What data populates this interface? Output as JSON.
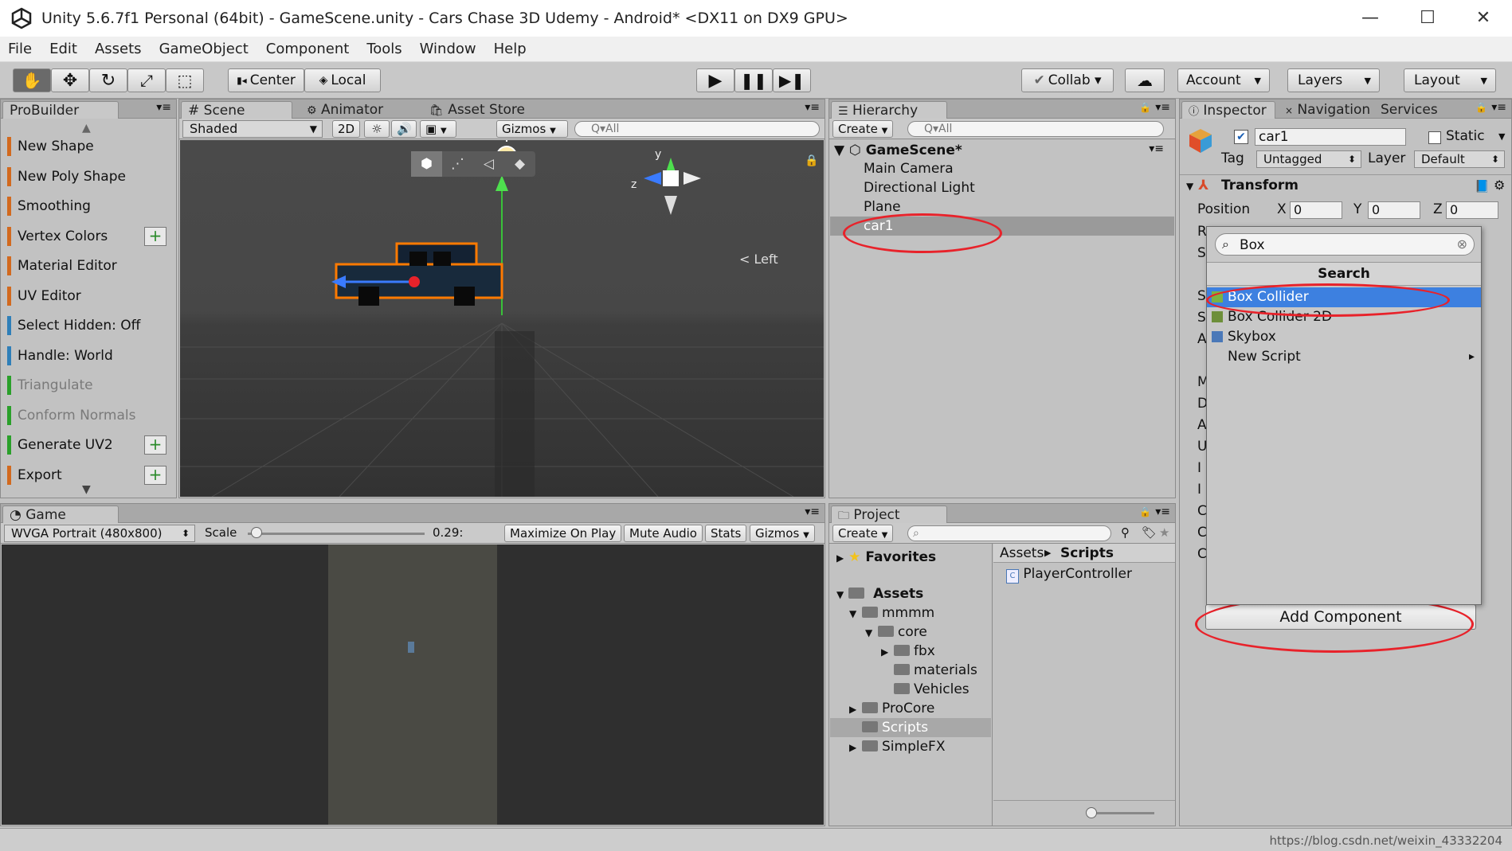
{
  "window": {
    "title": "Unity 5.6.7f1 Personal (64bit) - GameScene.unity - Cars Chase 3D Udemy - Android* <DX11 on DX9 GPU>",
    "minimize": "—",
    "maximize": "☐",
    "close": "✕"
  },
  "menu": [
    "File",
    "Edit",
    "Assets",
    "GameObject",
    "Component",
    "Tools",
    "Window",
    "Help"
  ],
  "toolbar": {
    "pivot": "Center",
    "space": "Local",
    "collab": "Collab ▾",
    "account": "Account",
    "layers": "Layers",
    "layout": "Layout"
  },
  "probuilder": {
    "tab": "ProBuilder",
    "items": [
      {
        "label": "New Shape",
        "color": "#d2691e",
        "plus": false,
        "dim": false
      },
      {
        "label": "New Poly Shape",
        "color": "#d2691e",
        "plus": false,
        "dim": false
      },
      {
        "label": "Smoothing",
        "color": "#d2691e",
        "plus": false,
        "dim": false
      },
      {
        "label": "Vertex Colors",
        "color": "#d2691e",
        "plus": true,
        "dim": false
      },
      {
        "label": "Material Editor",
        "color": "#d2691e",
        "plus": false,
        "dim": false
      },
      {
        "label": "UV Editor",
        "color": "#d2691e",
        "plus": false,
        "dim": false
      },
      {
        "label": "Select Hidden: Off",
        "color": "#2f7fb8",
        "plus": false,
        "dim": false
      },
      {
        "label": "Handle: World",
        "color": "#2f7fb8",
        "plus": false,
        "dim": false
      },
      {
        "label": "Triangulate",
        "color": "#2aa02a",
        "plus": false,
        "dim": true
      },
      {
        "label": "Conform Normals",
        "color": "#2aa02a",
        "plus": false,
        "dim": true
      },
      {
        "label": "Generate UV2",
        "color": "#2aa02a",
        "plus": true,
        "dim": false
      },
      {
        "label": "Export",
        "color": "#d2691e",
        "plus": true,
        "dim": false
      }
    ]
  },
  "scene": {
    "tabs": [
      "# Scene",
      "Animator",
      "Asset Store"
    ],
    "shading": "Shaded",
    "mode2d": "2D",
    "gizmos": "Gizmos",
    "search_placeholder": "Q▾All",
    "axis_y": "y",
    "axis_z": "z",
    "view_label": "< Left"
  },
  "game": {
    "tab": "Game",
    "resolution": "WVGA Portrait (480x800)",
    "scale_label": "Scale",
    "scale_value": "0.29:",
    "scale_fraction": 0.05,
    "maximize": "Maximize On Play",
    "mute": "Mute Audio",
    "stats": "Stats",
    "gizmos": "Gizmos"
  },
  "hierarchy": {
    "tab": "Hierarchy",
    "create": "Create",
    "search_placeholder": "Q▾All",
    "scene_name": "GameScene*",
    "objects": [
      "Main Camera",
      "Directional Light",
      "Plane",
      "car1"
    ],
    "selected": "car1"
  },
  "project": {
    "tab": "Project",
    "create": "Create",
    "favorites": "Favorites",
    "assets": "Assets",
    "tree": [
      {
        "label": "mmmm",
        "indent": 1,
        "arrow": "▼"
      },
      {
        "label": "core",
        "indent": 2,
        "arrow": "▼"
      },
      {
        "label": "fbx",
        "indent": 3,
        "arrow": "▶"
      },
      {
        "label": "materials",
        "indent": 3,
        "arrow": ""
      },
      {
        "label": "Vehicles",
        "indent": 3,
        "arrow": ""
      },
      {
        "label": "ProCore",
        "indent": 1,
        "arrow": "▶"
      },
      {
        "label": "Scripts",
        "indent": 1,
        "arrow": "",
        "selected": true
      },
      {
        "label": "SimpleFX",
        "indent": 1,
        "arrow": "▶"
      }
    ],
    "breadcrumb_root": "Assets",
    "breadcrumb_sep": "▶",
    "breadcrumb_current": "Scripts",
    "files": [
      "PlayerController"
    ]
  },
  "inspector": {
    "tabs": [
      "Inspector",
      "Navigation",
      "Services"
    ],
    "object_name": "car1",
    "static_label": "Static",
    "tag_label": "Tag",
    "tag_value": "Untagged",
    "layer_label": "Layer",
    "layer_value": "Default",
    "transform_title": "Transform",
    "position_label": "Position",
    "pos": {
      "x_label": "X",
      "x": "0",
      "y_label": "Y",
      "y": "0",
      "z_label": "Z",
      "z": "0"
    },
    "row_letters": [
      "R",
      "S",
      "",
      "S",
      "S",
      "A",
      "",
      "M",
      "D",
      "A",
      "U",
      "I",
      "I",
      "C",
      "C",
      "C"
    ],
    "add_component": "Add Component"
  },
  "component_search": {
    "query": "Box",
    "header": "Search",
    "results": [
      {
        "label": "Box Collider",
        "icon": "#7cb342",
        "highlighted": true
      },
      {
        "label": "Box Collider 2D",
        "icon": "#6d8f3a",
        "highlighted": false
      },
      {
        "label": "Skybox",
        "icon": "#4a78b8",
        "highlighted": false
      },
      {
        "label": "New Script",
        "icon": "",
        "highlighted": false,
        "submenu": "▸"
      }
    ]
  },
  "statusbar": {
    "watermark": "https://blog.csdn.net/weixin_43332204"
  },
  "colors": {
    "selection_blue": "#3d80e0",
    "annotation_red": "#e8222a",
    "selection_outline": "#ff7a00"
  }
}
